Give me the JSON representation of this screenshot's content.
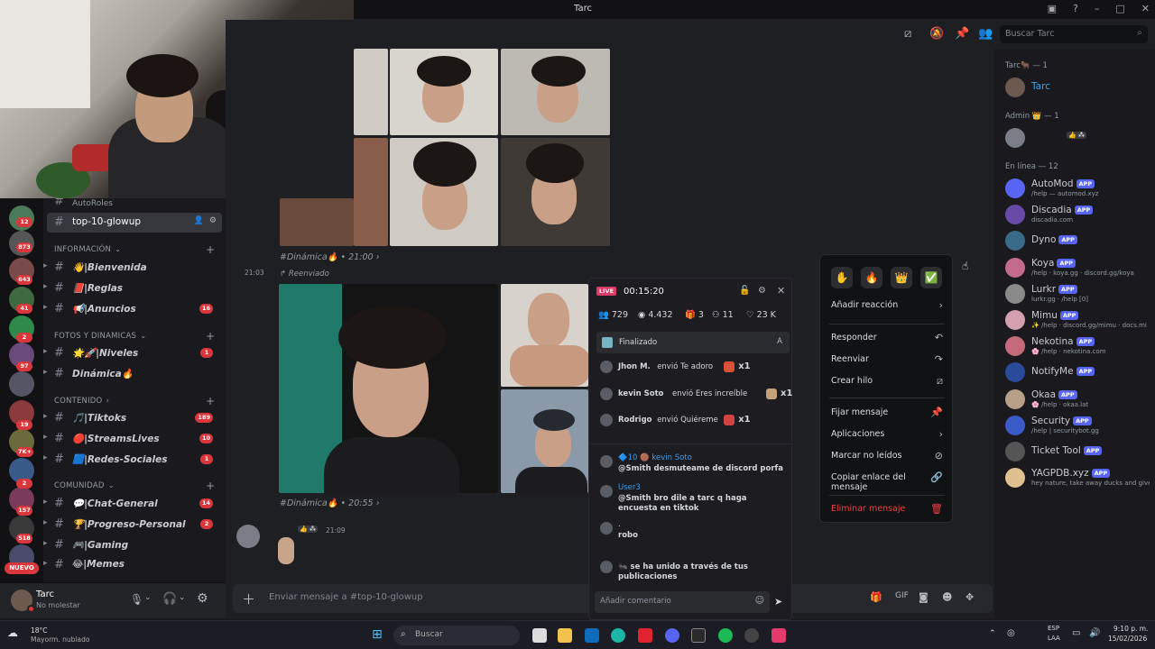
{
  "window": {
    "title": "Tarc"
  },
  "toolbar": {
    "search_placeholder": "Buscar Tarc"
  },
  "server_badges": [
    "12",
    "873",
    "643",
    "41",
    "2",
    "97",
    "19",
    "7K+",
    "2",
    "157",
    "518"
  ],
  "server_rail": {
    "nuevo_label": "NUEVO"
  },
  "channels": {
    "top_partial": "AutoRoles",
    "active": "top-10-glowup",
    "categories": [
      {
        "label": "INFORMACIÓN",
        "chevron": "⌄"
      },
      {
        "label": "FOTOS Y DINAMICAS",
        "chevron": "⌄"
      },
      {
        "label": "CONTENIDO",
        "chevron": "›"
      },
      {
        "label": "COMUNIDAD",
        "chevron": "⌄"
      }
    ],
    "items": [
      {
        "label": "👋|Bienvenida",
        "badge": ""
      },
      {
        "label": "📕|Reglas",
        "badge": ""
      },
      {
        "label": "📢|Anuncios",
        "badge": "16"
      },
      {
        "label": "🌟🚀|Niveles",
        "badge": "1"
      },
      {
        "label": "Dinámica🔥",
        "badge": ""
      },
      {
        "label": "🎵|Tiktoks",
        "badge": "189"
      },
      {
        "label": "🔴|StreamsLives",
        "badge": "10"
      },
      {
        "label": "🟦|Redes-Sociales",
        "badge": "1"
      },
      {
        "label": "💬|Chat-General",
        "badge": "14"
      },
      {
        "label": "🏆|Progreso-Personal",
        "badge": "2"
      },
      {
        "label": "🎮|Gaming",
        "badge": ""
      },
      {
        "label": "😂|Memes",
        "badge": ""
      }
    ]
  },
  "user_panel": {
    "name": "Tarc",
    "status": "No molestar"
  },
  "messages": {
    "meta1": "#Dinámica🔥 • 21:00 ›",
    "time2": "21:03",
    "forwarded": "↱ Reenviado",
    "meta2": "#Dinámica🔥 • 20:55 ›",
    "last_time": "21:09",
    "last_badge": "👍 ⁂"
  },
  "composer": {
    "placeholder": "Enviar mensaje a #top-10-glowup"
  },
  "live": {
    "badge": "LIVE",
    "timer": "00:15:20",
    "stats": {
      "viewers": "729",
      "views": "4.432",
      "gifts": "3",
      "joins": "11",
      "likes": "23 K"
    },
    "finalizado": "Finalizado",
    "finalizado_letter": "A",
    "events": [
      {
        "user": "Jhon M.",
        "text": "envió Te adoro",
        "count": "x1"
      },
      {
        "user": "kevin Soto",
        "text": "envió Eres increíble",
        "count": "x1"
      },
      {
        "user": "Rodrigo",
        "text": "envió Quiéreme",
        "count": "x1"
      }
    ],
    "comments": [
      {
        "user": "🔷10 🟤 kevin Soto",
        "text": "@Smith desmuteame de discord porfa"
      },
      {
        "user": "User3",
        "text": "@Smith bro dile a tarc q haga encuesta en tiktok"
      },
      {
        "user": ".",
        "text": "robo"
      },
      {
        "user": "",
        "text": "🐜 se ha unido a través de tus publicaciones"
      }
    ],
    "comment_placeholder": "Añadir comentario"
  },
  "context_menu": {
    "reactions": [
      "✋",
      "🔥",
      "👑",
      "✅"
    ],
    "items": [
      "Añadir reacción",
      "Responder",
      "Reenviar",
      "Crear hilo",
      "Fijar mensaje",
      "Aplicaciones",
      "Marcar no leídos",
      "Copiar enlace del mensaje",
      "Eliminar mensaje"
    ]
  },
  "members": {
    "groups": [
      "Tarc🐂 — 1",
      "Admin 👑 — 1",
      "En línea — 12"
    ],
    "owner": {
      "name": "Tarc"
    },
    "admin_badge": "👍 ⁂",
    "app_tag": "APP",
    "list": [
      {
        "name": "AutoMod",
        "status": "/help — automod.xyz"
      },
      {
        "name": "Discadia",
        "status": "discadia.com"
      },
      {
        "name": "Dyno",
        "status": ""
      },
      {
        "name": "Koya",
        "status": "/help · koya.gg · discord.gg/koya"
      },
      {
        "name": "Lurkr",
        "status": "lurkr.gg · /help [0]"
      },
      {
        "name": "Mimu",
        "status": "✨ /help · discord.gg/mimu · docs.mi"
      },
      {
        "name": "Nekotina",
        "status": "🌸 /help · nekotina.com"
      },
      {
        "name": "NotifyMe",
        "status": ""
      },
      {
        "name": "Okaa",
        "status": "🌸 /help · okaa.lat"
      },
      {
        "name": "Security",
        "status": "/help | securitybot.gg"
      },
      {
        "name": "Ticket Tool",
        "status": ""
      },
      {
        "name": "YAGPDB.xyz",
        "status": "hey nature, take away ducks and give"
      }
    ]
  },
  "taskbar": {
    "weather_temp": "18°C",
    "weather_desc": "Mayorm. nublado",
    "search": "Buscar",
    "lang1": "ESP",
    "lang2": "LAA",
    "time": "9:10 p. m.",
    "date": "15/02/2026"
  },
  "colors": {
    "accent": "#5865f2",
    "danger": "#da373c",
    "link": "#3ba3f0",
    "live": "#e33b6a"
  }
}
